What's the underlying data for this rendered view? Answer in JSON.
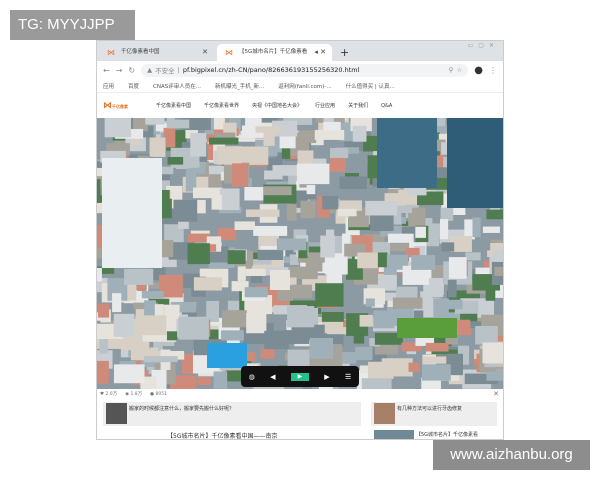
{
  "overlay_label": "TG: MYYJJPP",
  "watermark": "www.aizhanbu.org",
  "browser": {
    "tabs": [
      {
        "label": "千亿像素看中国",
        "active": false
      },
      {
        "label": "【5G城市名片】千亿像素看",
        "active": true
      }
    ],
    "address": {
      "security": "不安全",
      "url": "pf.bigpixel.cn/zh-CN/pano/826636193155256320.html"
    },
    "bookmarks": [
      "应用",
      "百度",
      "CNAS评审人员在...",
      "新机曝光_手机_新...",
      "返利网(fanli.com)-...",
      "什么值得买 | 认真..."
    ]
  },
  "site": {
    "brand": "千亿像素",
    "nav": [
      "千亿像素看中国",
      "千亿像素看世界",
      "央视《中国地名大会》",
      "行业应用",
      "关于我们",
      "Q&A"
    ]
  },
  "player": {
    "controls": [
      "globe",
      "prev",
      "play",
      "next",
      "list"
    ]
  },
  "stats": {
    "likes": "2.0万",
    "views": "1.8万",
    "comments": "8051"
  },
  "cards": [
    {
      "text": "搬家的时候都注意什么，搬家要先搬什么好呢？"
    },
    {
      "text": "有几种方法可以进行牙齿修复"
    },
    {
      "text": "【5G城市名片】千亿像素看"
    }
  ],
  "caption": "【5G城市名片】千亿像素看中国——南京"
}
